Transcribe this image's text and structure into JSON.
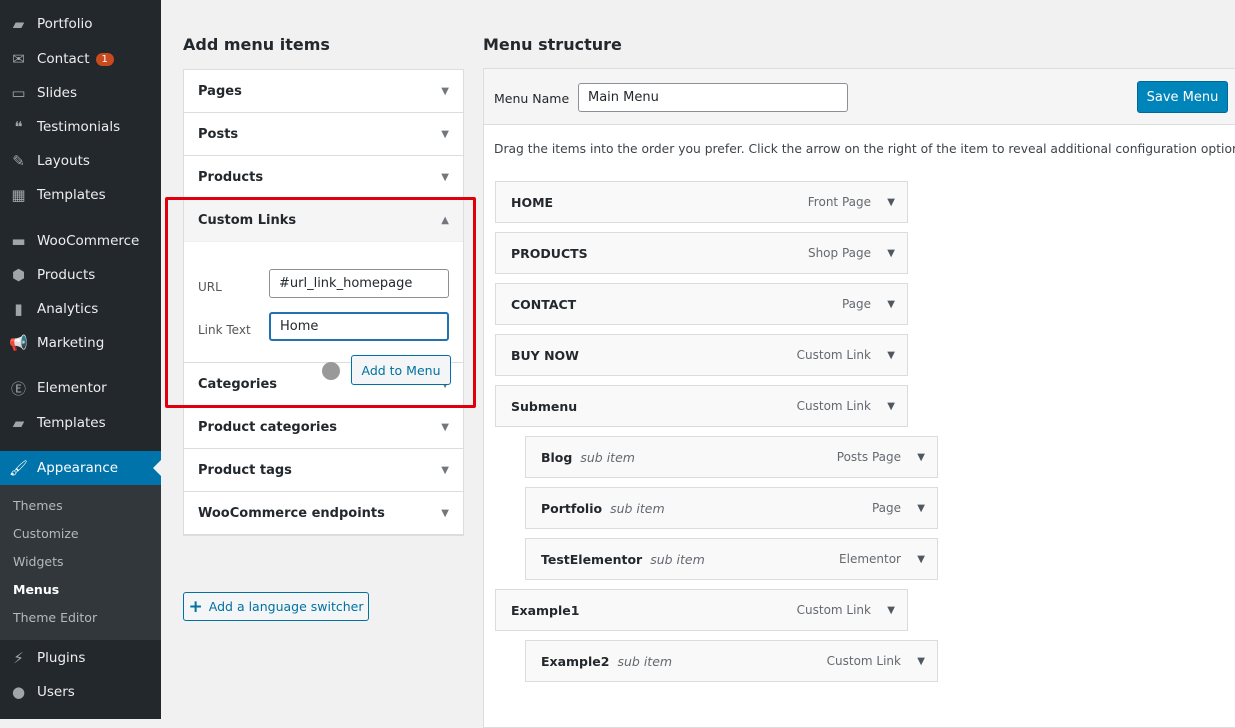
{
  "sidebar": {
    "items": [
      {
        "label": "Portfolio",
        "icon": "folder-icon"
      },
      {
        "label": "Contact",
        "icon": "mail-icon",
        "badge": "1"
      },
      {
        "label": "Slides",
        "icon": "slides-icon"
      },
      {
        "label": "Testimonials",
        "icon": "quote-icon"
      },
      {
        "label": "Layouts",
        "icon": "pencil-icon"
      },
      {
        "label": "Templates",
        "icon": "templates-icon"
      },
      {
        "label": "WooCommerce",
        "icon": "woo-icon"
      },
      {
        "label": "Products",
        "icon": "box-icon"
      },
      {
        "label": "Analytics",
        "icon": "bar-chart-icon"
      },
      {
        "label": "Marketing",
        "icon": "megaphone-icon"
      },
      {
        "label": "Elementor",
        "icon": "elementor-icon"
      },
      {
        "label": "Templates",
        "icon": "folder-open-icon"
      },
      {
        "label": "Appearance",
        "icon": "brush-icon"
      },
      {
        "label": "Plugins",
        "icon": "plug-icon"
      },
      {
        "label": "Users",
        "icon": "user-icon"
      }
    ],
    "submenu": [
      "Themes",
      "Customize",
      "Widgets",
      "Menus",
      "Theme Editor"
    ],
    "active": "Appearance",
    "current_sub": "Menus",
    "accent": "#0073aa"
  },
  "add_items": {
    "title": "Add menu items",
    "sections_top": [
      "Pages",
      "Posts",
      "Products"
    ],
    "custom": {
      "title": "Custom Links",
      "url_label": "URL",
      "url_value": "#url_link_homepage",
      "text_label": "Link Text",
      "text_value": "Home",
      "add_button": "Add to Menu"
    },
    "sections_bottom": [
      "Categories",
      "Product categories",
      "Product tags",
      "WooCommerce endpoints"
    ],
    "language_switcher": "Add a language switcher"
  },
  "structure": {
    "title": "Menu structure",
    "name_label": "Menu Name",
    "name_value": "Main Menu",
    "save": "Save Menu",
    "instructions": "Drag the items into the order you prefer. Click the arrow on the right of the item to reveal additional configuration options.",
    "items": [
      {
        "title": "HOME",
        "type": "Front Page",
        "sub": ""
      },
      {
        "title": "PRODUCTS",
        "type": "Shop Page",
        "sub": ""
      },
      {
        "title": "CONTACT",
        "type": "Page",
        "sub": ""
      },
      {
        "title": "BUY NOW",
        "type": "Custom Link",
        "sub": ""
      },
      {
        "title": "Submenu",
        "type": "Custom Link",
        "sub": ""
      },
      {
        "title": "Blog",
        "type": "Posts Page",
        "sub": "sub item"
      },
      {
        "title": "Portfolio",
        "type": "Page",
        "sub": "sub item"
      },
      {
        "title": "TestElementor",
        "type": "Elementor",
        "sub": "sub item"
      },
      {
        "title": "Example1",
        "type": "Custom Link",
        "sub": ""
      },
      {
        "title": "Example2",
        "type": "Custom Link",
        "sub": "sub item"
      }
    ]
  }
}
